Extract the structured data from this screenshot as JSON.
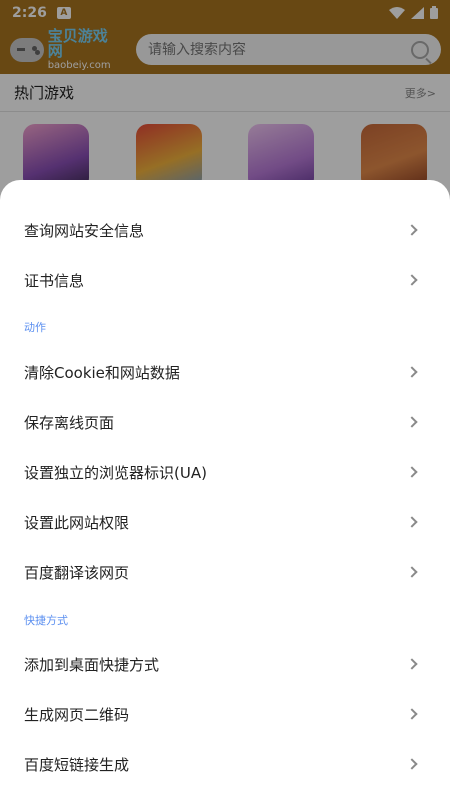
{
  "status_bar": {
    "time": "2:26",
    "notif_letter": "A"
  },
  "header": {
    "logo_cn": "宝贝游戏网",
    "logo_en": "baobeiy.com",
    "search_placeholder": "请输入搜索内容"
  },
  "hot": {
    "title": "热门游戏",
    "more": "更多>"
  },
  "sheet": {
    "group1": [
      {
        "label": "查询网站安全信息"
      },
      {
        "label": "证书信息"
      }
    ],
    "section_actions": "动作",
    "group2": [
      {
        "label": "清除Cookie和网站数据"
      },
      {
        "label": "保存离线页面"
      },
      {
        "label": "设置独立的浏览器标识(UA)"
      },
      {
        "label": "设置此网站权限"
      },
      {
        "label": "百度翻译该网页"
      }
    ],
    "section_shortcuts": "快捷方式",
    "group3": [
      {
        "label": "添加到桌面快捷方式"
      },
      {
        "label": "生成网页二维码"
      },
      {
        "label": "百度短链接生成"
      }
    ]
  }
}
